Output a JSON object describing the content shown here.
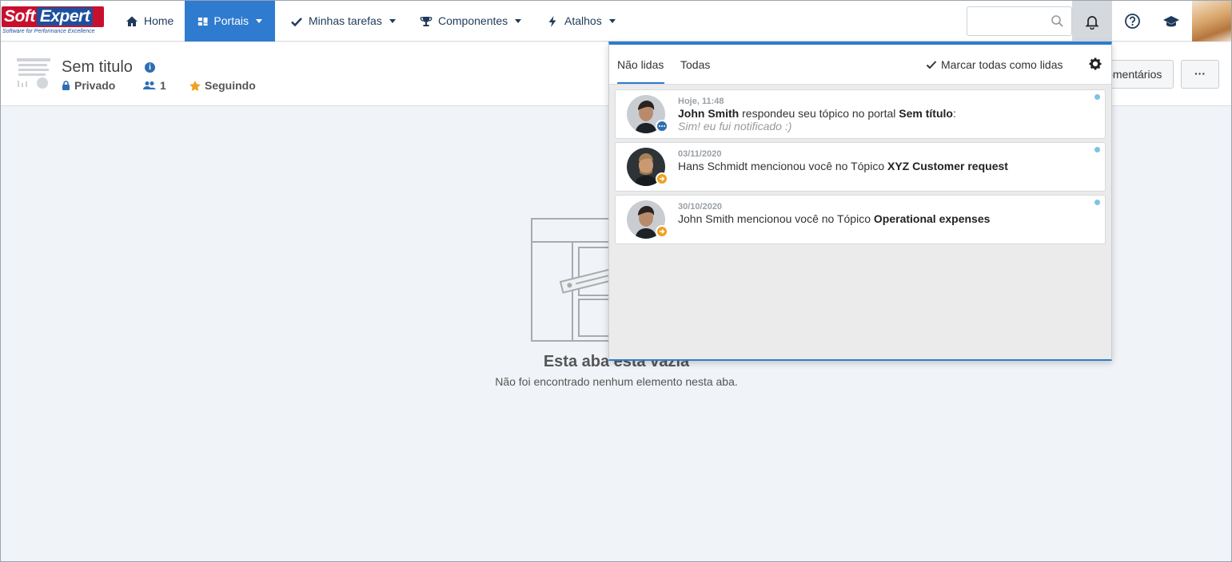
{
  "app": {
    "logo_brand_soft": "Soft",
    "logo_brand_expert": "Expert",
    "logo_tagline": "Software for Performance Excellence"
  },
  "nav": {
    "items": [
      {
        "label": "Home",
        "icon": "home-icon"
      },
      {
        "label": "Portais",
        "icon": "portal-grid-icon",
        "active": true,
        "dropdown": true
      },
      {
        "label": "Minhas tarefas",
        "icon": "check-icon",
        "dropdown": true
      },
      {
        "label": "Componentes",
        "icon": "trophy-icon",
        "dropdown": true
      },
      {
        "label": "Atalhos",
        "icon": "bolt-icon",
        "dropdown": true
      }
    ],
    "search_placeholder": ""
  },
  "portal": {
    "title": "Sem titulo",
    "privacy": "Privado",
    "members": "1",
    "following": "Seguindo",
    "comments_label": "Comentários",
    "more_label": "···"
  },
  "empty": {
    "title": "Esta aba está vazia",
    "subtitle": "Não foi encontrado nenhum elemento nesta aba."
  },
  "notifications": {
    "tabs": [
      {
        "label": "Não lidas",
        "active": true
      },
      {
        "label": "Todas",
        "active": false
      }
    ],
    "mark_all_label": "Marcar todas como lidas",
    "items": [
      {
        "date": "Hoje, 11:48",
        "actor": "John Smith",
        "text": " respondeu seu tópico no portal ",
        "target": "Sem título",
        "suffix": ":",
        "quote": "Sim! eu fui notificado :)",
        "badge": "reply",
        "unread": true
      },
      {
        "date": "03/11/2020",
        "actor": "",
        "text": "Hans Schmidt mencionou você no Tópico ",
        "target": "XYZ Customer request",
        "suffix": "",
        "quote": "",
        "badge": "mention",
        "unread": true
      },
      {
        "date": "30/10/2020",
        "actor": "",
        "text": "John Smith mencionou você no Tópico ",
        "target": "Operational expenses",
        "suffix": "",
        "quote": "",
        "badge": "mention",
        "unread": true
      }
    ]
  },
  "colors": {
    "accent": "#2f7bcf",
    "nav_text": "#1f3a5a",
    "unread_dot": "#7cc3e6",
    "mention_badge": "#f0a020",
    "reply_badge": "#2f6db3"
  }
}
